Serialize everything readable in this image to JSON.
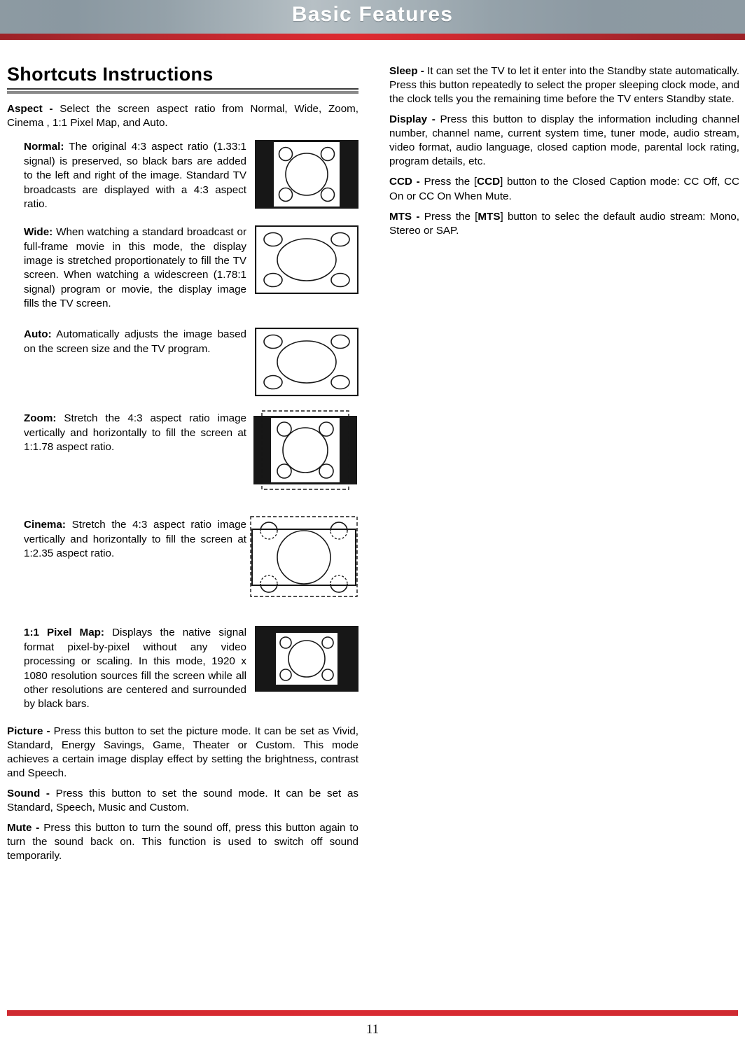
{
  "header": {
    "title": "Basic Features",
    "band_color": "#93a0a8",
    "rule_color": "#cf2a31"
  },
  "left_column": {
    "section_title": "Shortcuts Instructions",
    "aspect": {
      "label": "Aspect - ",
      "text": "Select the screen aspect ratio from Normal, Wide, Zoom, Cinema , 1:1 Pixel Map, and Auto."
    },
    "modes": [
      {
        "label": "Normal:",
        "text": " The original 4:3 aspect ratio (1.33:1 signal) is preserved, so black bars are added to the left and right of the image. Standard TV broadcasts are displayed with a 4:3 aspect ratio.",
        "diagram": "normal-aspect-diagram"
      },
      {
        "label": "Wide:",
        "text": " When watching a standard broadcast or full-frame movie in this mode, the display image is stretched proportionately to fill the TV screen. When watching a widescreen (1.78:1 signal) program or movie, the display image fills the TV screen.",
        "diagram": "wide-aspect-diagram"
      },
      {
        "label": "Auto:",
        "text": " Automatically adjusts the image based on the screen size and the TV program.",
        "diagram": "auto-aspect-diagram"
      },
      {
        "label": "Zoom:",
        "text": " Stretch the 4:3 aspect ratio image vertically and horizontally to fill the screen at 1:1.78 aspect ratio.",
        "diagram": "zoom-aspect-diagram"
      },
      {
        "label": "Cinema:",
        "text": " Stretch the 4:3 aspect ratio image vertically and horizontally to fill the screen at 1:2.35 aspect ratio.",
        "diagram": "cinema-aspect-diagram"
      },
      {
        "label": "1:1 Pixel Map:",
        "text": " Displays the native signal format pixel-by-pixel without any video processing or scaling.  In this mode, 1920 x 1080 resolution sources fill the screen while all other resolutions are centered and surrounded by black bars.",
        "diagram": "pixel-map-aspect-diagram"
      }
    ],
    "picture": {
      "label": "Picture - ",
      "text": "Press this button to set the picture mode. It can be set as Vivid, Standard, Energy Savings, Game, Theater or Custom. This mode achieves a certain image display effect by setting the brightness, contrast and Speech."
    },
    "sound": {
      "label": "Sound - ",
      "text": "Press this button to set the sound mode. It can be set as Standard, Speech, Music and Custom."
    },
    "mute": {
      "label": "Mute - ",
      "text": "Press this button to turn the sound off, press this button again to turn the sound back on. This function is used to switch off sound temporarily."
    }
  },
  "right_column": {
    "sleep": {
      "label": "Sleep - ",
      "text": "It can set the TV to let it enter into the Standby state automatically. Press this button repeatedly to select the proper sleeping clock mode, and the clock tells you the remaining time before the TV enters Standby state."
    },
    "display": {
      "label": "Display - ",
      "text": "Press this button to display the information including channel number, channel name, current system time, tuner mode, audio stream, video format, audio language, closed caption mode, parental lock rating, program details, etc."
    },
    "ccd": {
      "label": "CCD - ",
      "text_before": "Press the [",
      "key": "CCD",
      "text_after": "] button to the Closed Caption mode: CC Off, CC On or CC On When Mute."
    },
    "mts": {
      "label": "MTS - ",
      "text_before": "Press the [",
      "key": "MTS",
      "text_after": "] button to selec the default audio stream: Mono, Stereo or SAP."
    }
  },
  "footer": {
    "page_number": "11",
    "rule_color": "#d42a31"
  }
}
